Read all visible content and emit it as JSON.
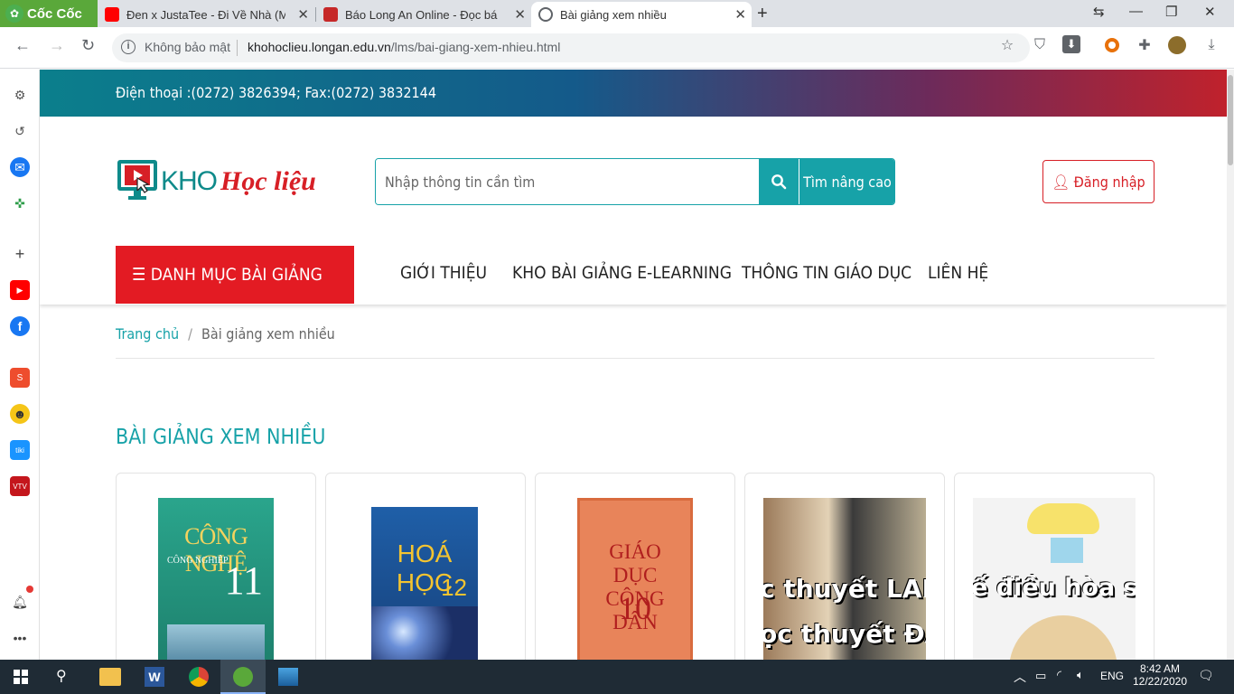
{
  "browser": {
    "brand": "Cốc Cốc",
    "tabs": [
      {
        "title": "Đen x JustaTee - Đi Về Nhà (M"
      },
      {
        "title": "Báo Long An Online - Đọc bá"
      },
      {
        "title": "Bài giảng xem nhiều"
      }
    ],
    "address": {
      "security": "Không bảo mật",
      "host": "khohoclieu.longan.edu.vn",
      "path": "/lms/bai-giang-xem-nhieu.html"
    }
  },
  "site": {
    "contact": "Điện thoại :(0272) 3826394; Fax:(0272) 3832144",
    "logo": {
      "kho": "KHO",
      "hoc": "Học liệu"
    },
    "search": {
      "placeholder": "Nhập thông tin cần tìm",
      "advanced": "Tìm nâng cao"
    },
    "login": "Đăng nhập",
    "menu_button": "☰ DANH MỤC BÀI GIẢNG",
    "nav": [
      "GIỚI THIỆU",
      "KHO BÀI GIẢNG E-LEARNING",
      "THÔNG TIN GIÁO DỤC",
      "LIÊN HỆ"
    ],
    "breadcrumb": {
      "home": "Trang chủ",
      "separator": "/",
      "current": "Bài giảng xem nhiều"
    },
    "section_title": "BÀI GIẢNG XEM NHIỀU",
    "cards": [
      {
        "cover_title": "CÔNG NGHỆ",
        "cover_sub": "CÔNG NGHIỆP",
        "cover_num": "11",
        "color": "#2aa58c"
      },
      {
        "cover_title": "HOÁ HỌC",
        "cover_num": "12",
        "color": "#1f5fa8"
      },
      {
        "cover_title": "GIÁO DỤC CÔNG DÂN",
        "cover_num": "10",
        "color": "#e8845a"
      },
      {
        "cover_lines": [
          "c thuyết LAMA",
          "ọc thuyết ĐAC"
        ]
      },
      {
        "cover_lines": [
          "ế điều hòa sinh"
        ]
      }
    ]
  },
  "taskbar": {
    "time": "8:42 AM",
    "date": "12/22/2020",
    "lang": "ENG"
  },
  "colors": {
    "teal": "#17a2a8",
    "red": "#e31b23"
  }
}
